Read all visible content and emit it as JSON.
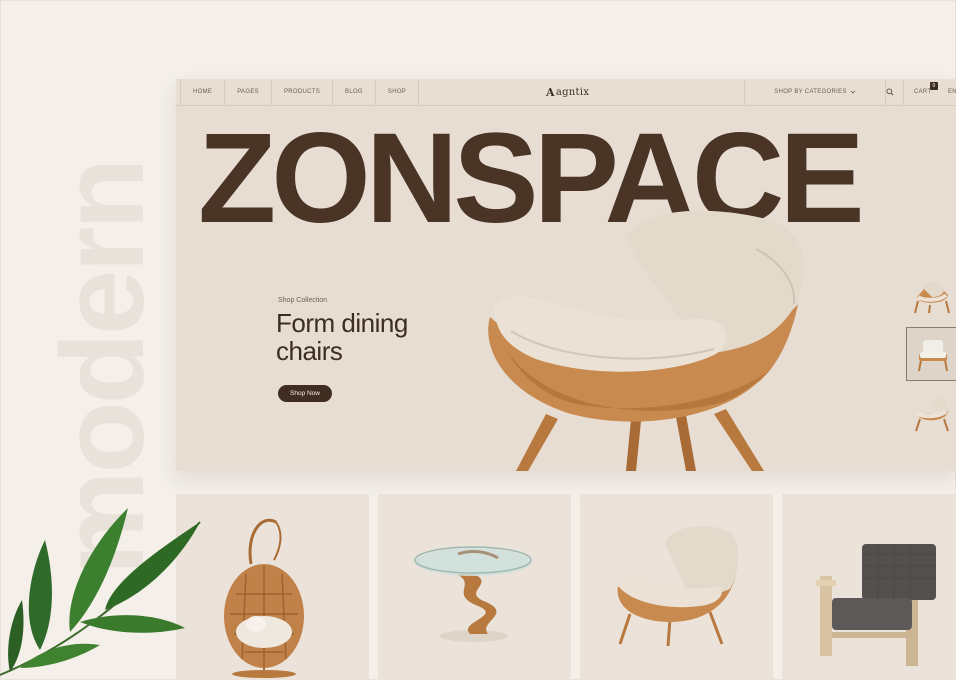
{
  "watermark": "modern",
  "nav": {
    "items": [
      {
        "label": "HOME"
      },
      {
        "label": "PAGES"
      },
      {
        "label": "PRODUCTS"
      },
      {
        "label": "BLOG"
      },
      {
        "label": "SHOP"
      }
    ],
    "logo": "agntix",
    "logo_mark": "A",
    "categories": "SHOP BY CATEGORIES",
    "cart_label": "CART",
    "cart_count": "0",
    "extra": "EN"
  },
  "hero": {
    "title": "ZONSPACE",
    "eyebrow": "Shop Collection",
    "headline_line1": "Form dining",
    "headline_line2": "chairs",
    "button": "Shop Now"
  },
  "thumbnails": [
    {
      "name": "armchair-tan",
      "active": false
    },
    {
      "name": "armchair-white",
      "active": true
    },
    {
      "name": "armchair-cream",
      "active": false
    }
  ],
  "products": [
    {
      "name": "hanging-egg-chair"
    },
    {
      "name": "glass-side-table"
    },
    {
      "name": "wingback-chair"
    },
    {
      "name": "wood-lounge-chair"
    }
  ],
  "colors": {
    "background": "#f4efe9",
    "hero_bg": "#e7ddd3",
    "title": "#4a3426",
    "button": "#3f2d22",
    "wood": "#c1824a",
    "fabric": "#e6dccf"
  }
}
